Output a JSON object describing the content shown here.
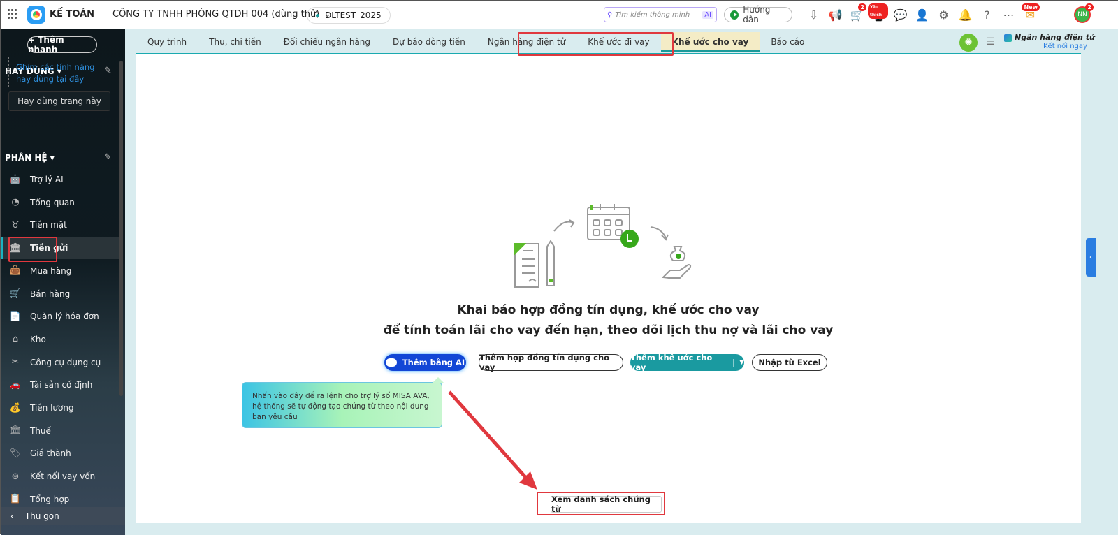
{
  "header": {
    "app_name": "KẾ TOÁN",
    "company": "CÔNG TY TNHH PHÒNG QTDH 004 (dùng thử)",
    "database": "DLTEST_2025",
    "search_placeholder": "Tìm kiếm thông minh",
    "search_ai": "AI",
    "guide": "Hướng dẫn",
    "cart_badge": "2",
    "favorite_badge": "Yêu thích",
    "new_badge": "New",
    "avatar": "NN",
    "avatar_badge": "2"
  },
  "sidebar": {
    "quick_add": "+ Thêm nhanh",
    "favorites_title": "HAY DÙNG",
    "pin_hint": "Ghim các tính năng hay dùng tại đây",
    "favorite_page": "Hay dùng trang này",
    "modules_title": "PHÂN HỆ",
    "items": [
      {
        "label": "Trợ lý AI"
      },
      {
        "label": "Tổng quan"
      },
      {
        "label": "Tiền mặt"
      },
      {
        "label": "Tiền gửi"
      },
      {
        "label": "Mua hàng"
      },
      {
        "label": "Bán hàng"
      },
      {
        "label": "Quản lý hóa đơn"
      },
      {
        "label": "Kho"
      },
      {
        "label": "Công cụ dụng cụ"
      },
      {
        "label": "Tài sản cố định"
      },
      {
        "label": "Tiền lương"
      },
      {
        "label": "Thuế"
      },
      {
        "label": "Giá thành"
      },
      {
        "label": "Kết nối vay vốn"
      },
      {
        "label": "Tổng hợp"
      }
    ],
    "active": "Tiền gửi",
    "collapse": "Thu gọn"
  },
  "tabs": [
    {
      "label": "Quy trình"
    },
    {
      "label": "Thu, chi tiền"
    },
    {
      "label": "Đối chiếu ngân hàng"
    },
    {
      "label": "Dự báo dòng tiền"
    },
    {
      "label": "Ngân hàng điện tử"
    },
    {
      "label": "Khế ước đi vay"
    },
    {
      "label": "Khế ước cho vay"
    },
    {
      "label": "Báo cáo"
    }
  ],
  "active_tab": "Khế ước cho vay",
  "ebank": {
    "title": "Ngân hàng điện tử",
    "link": "Kết nối ngay"
  },
  "main": {
    "line1": "Khai báo hợp đồng tín dụng, khế ước cho vay",
    "line2": "để tính toán lãi cho vay đến hạn, theo dõi lịch thu nợ và lãi cho vay",
    "btn_ai": "Thêm bằng AI",
    "btn_contract": "Thêm hợp đồng tín dụng cho vay",
    "btn_loan": "Thêm khế ước cho vay",
    "btn_excel": "Nhập từ Excel",
    "tooltip": "Nhấn vào đây để ra lệnh cho trợ lý số MISA AVA, hệ thống sẽ tự động tạo chứng từ theo nội dung bạn yêu cầu",
    "view_list": "Xem danh sách chứng từ"
  }
}
